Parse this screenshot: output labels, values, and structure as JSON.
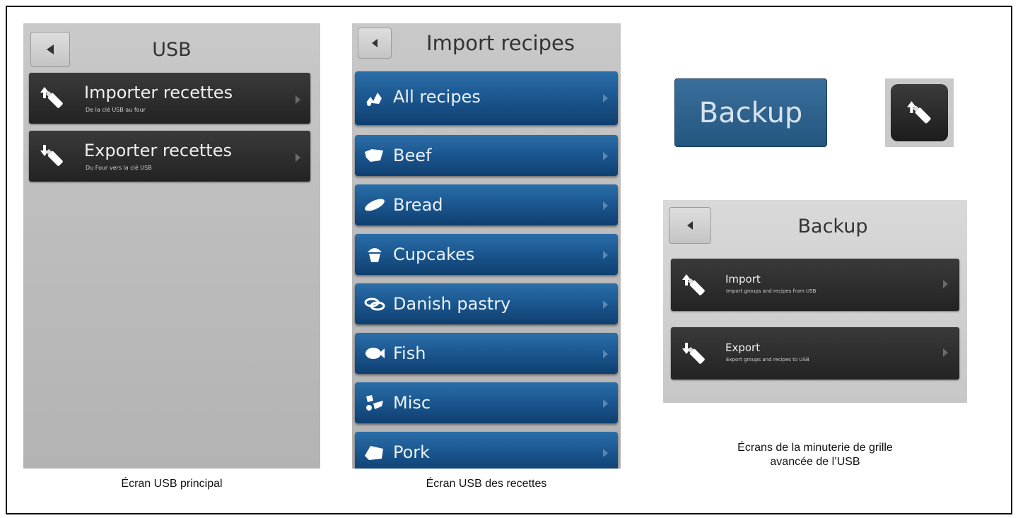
{
  "panel_usb_main": {
    "title": "USB",
    "rows": [
      {
        "label": "Importer recettes",
        "sublabel": "De la clé USB au four",
        "icon": "usb-import-icon"
      },
      {
        "label": "Exporter recettes",
        "sublabel": "Du Four vers la clé USB",
        "icon": "usb-export-icon"
      }
    ],
    "caption": "Écran USB principal"
  },
  "panel_import_recipes": {
    "title": "Import recipes",
    "rows": [
      {
        "label": "All recipes",
        "icon": "all-recipes-icon"
      },
      {
        "label": "Beef",
        "icon": "beef-icon"
      },
      {
        "label": "Bread",
        "icon": "bread-icon"
      },
      {
        "label": "Cupcakes",
        "icon": "cupcake-icon"
      },
      {
        "label": "Danish pastry",
        "icon": "pastry-icon"
      },
      {
        "label": "Fish",
        "icon": "fish-icon"
      },
      {
        "label": "Misc",
        "icon": "misc-icon"
      },
      {
        "label": "Pork",
        "icon": "pork-icon"
      }
    ],
    "caption": "Écran USB des recettes"
  },
  "panel_backup": {
    "backup_button_label": "Backup",
    "title": "Backup",
    "rows": [
      {
        "label": "Import",
        "sublabel": "Import groups and recipes from USB",
        "icon": "usb-import-icon"
      },
      {
        "label": "Export",
        "sublabel": "Export groups and recipes to USB",
        "icon": "usb-export-icon"
      }
    ],
    "caption_line1": "Écrans de la minuterie de grille",
    "caption_line2": "avancée de l’USB"
  },
  "colors": {
    "steel_bg": "#bdbdbd",
    "dark_row": "#2d2d2d",
    "blue_row": "#1c5891",
    "backup_button": "#2a5d8a"
  }
}
